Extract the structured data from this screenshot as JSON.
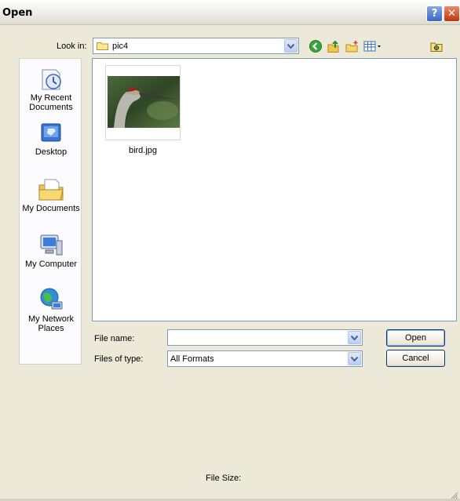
{
  "window": {
    "title": "Open"
  },
  "lookin": {
    "label": "Look in:",
    "value": "pic4"
  },
  "places": [
    {
      "label_lines": [
        "My Recent",
        "Documents"
      ]
    },
    {
      "label_lines": [
        "Desktop"
      ]
    },
    {
      "label_lines": [
        "My Documents"
      ]
    },
    {
      "label_lines": [
        "My Computer"
      ]
    },
    {
      "label_lines": [
        "My Network",
        "Places"
      ]
    }
  ],
  "files": [
    {
      "name": "bird.jpg"
    }
  ],
  "form": {
    "filename_label": "File name:",
    "filename_value": "",
    "filetype_label": "Files of type:",
    "filetype_value": "All Formats"
  },
  "buttons": {
    "open": "Open",
    "cancel": "Cancel"
  },
  "status": {
    "file_size_label": "File Size:"
  },
  "colors": {
    "accent": "#316ac5",
    "close": "#c2350f",
    "help": "#3966c9"
  }
}
